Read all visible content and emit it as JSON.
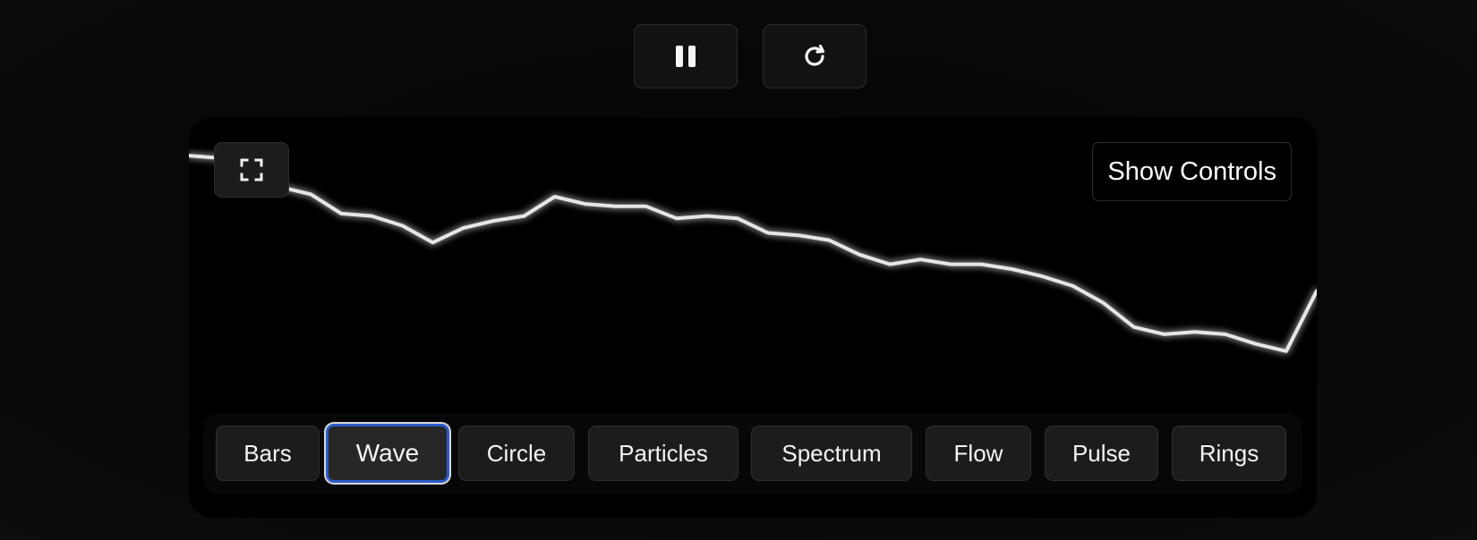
{
  "toolbar": {
    "pause_icon": "pause-icon",
    "restart_icon": "restart-icon"
  },
  "visualizer": {
    "fullscreen_icon": "fullscreen-icon",
    "show_controls_label": "Show Controls",
    "selected_mode": "Wave",
    "modes": [
      {
        "label": "Bars"
      },
      {
        "label": "Wave"
      },
      {
        "label": "Circle"
      },
      {
        "label": "Particles"
      },
      {
        "label": "Spectrum"
      },
      {
        "label": "Flow"
      },
      {
        "label": "Pulse"
      },
      {
        "label": "Rings"
      }
    ],
    "waveform": {
      "stroke_color": "#e6e6e6",
      "levels": [
        0.67,
        0.66,
        0.54,
        0.54,
        0.51,
        0.43,
        0.42,
        0.38,
        0.31,
        0.37,
        0.4,
        0.42,
        0.5,
        0.47,
        0.46,
        0.46,
        0.41,
        0.42,
        0.41,
        0.35,
        0.34,
        0.32,
        0.26,
        0.22,
        0.24,
        0.22,
        0.22,
        0.2,
        0.17,
        0.13,
        0.06,
        -0.04,
        -0.07,
        -0.06,
        -0.07,
        -0.11,
        -0.14,
        0.11
      ]
    }
  },
  "colors": {
    "page_background": "#080808",
    "panel_background": "#000000",
    "button_background": "#1c1c1c",
    "active_border": "#2d5cc9"
  }
}
